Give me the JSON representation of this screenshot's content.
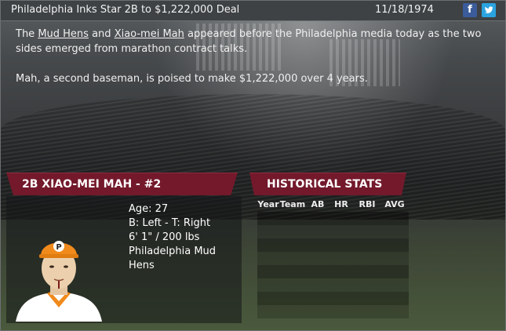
{
  "news": {
    "headline": "Philadelphia Inks Star 2B to $1,222,000 Deal",
    "date": "11/18/1974",
    "share": {
      "facebook_icon": "f",
      "twitter_icon": "t"
    },
    "paragraph1": {
      "pre": "The ",
      "team_link": "Mud Hens",
      "mid": " and ",
      "player_link": "Xiao-mei Mah",
      "post": " appeared before the Philadelphia media today as the two sides emerged from marathon contract talks."
    },
    "paragraph2": "Mah, a second baseman, is poised to make $1,222,000 over 4 years."
  },
  "player": {
    "banner": "2B XIAO-MEI MAH - #2",
    "age": "Age: 27",
    "bats_throws": "B: Left - T: Right",
    "size": "6' 1\" / 200 lbs",
    "team": "Philadelphia Mud Hens",
    "cap_letter": "P",
    "colors": {
      "cap": "#f08a1c",
      "jersey": "#ffffff",
      "accent": "#f08a1c"
    }
  },
  "stats": {
    "banner": "HISTORICAL STATS",
    "columns": [
      "Year",
      "Team",
      "AB",
      "HR",
      "RBI",
      "AVG"
    ],
    "rows": []
  },
  "theme": {
    "banner_color": "#73192b"
  }
}
